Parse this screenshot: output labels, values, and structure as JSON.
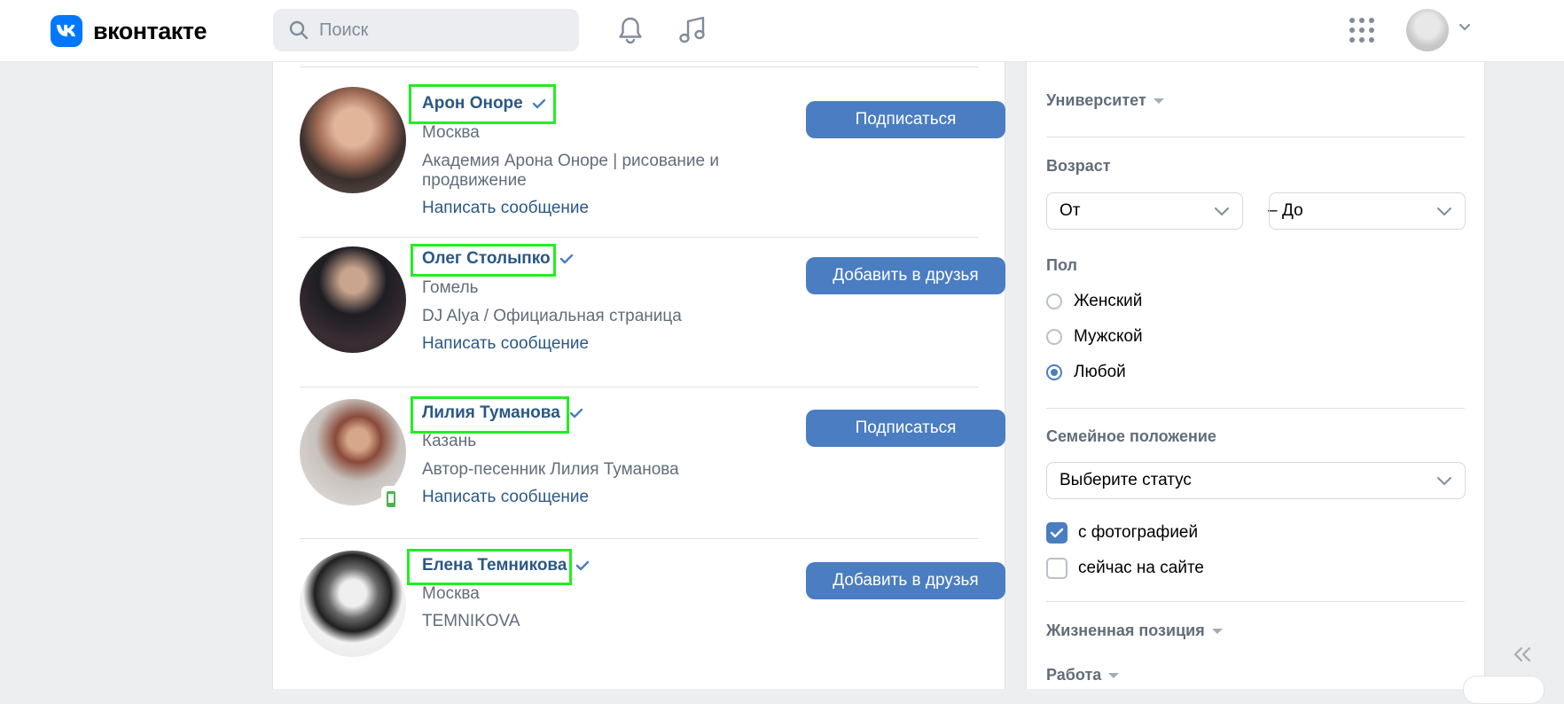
{
  "header": {
    "logo_text": "вконтакте",
    "search_placeholder": "Поиск"
  },
  "people": [
    {
      "name": "Арон Оноре",
      "city": "Москва",
      "desc1": "Академия Арона Оноре | рисование и",
      "desc2": "продвижение",
      "message": "Написать сообщение",
      "button": "Подписаться"
    },
    {
      "name": "Олег Столыпко",
      "city": "Гомель",
      "desc1": "DJ Alya / Официальная страница",
      "message": "Написать сообщение",
      "button": "Добавить в друзья"
    },
    {
      "name": "Лилия Туманова",
      "city": "Казань",
      "desc1": "Автор-песенник Лилия Туманова",
      "message": "Написать сообщение",
      "button": "Подписаться"
    },
    {
      "name": "Елена Темникова",
      "city": "Москва",
      "desc1": "TEMNIKOVA",
      "button": "Добавить в друзья"
    }
  ],
  "filters": {
    "university": "Университет",
    "age_label": "Возраст",
    "age_from": "От",
    "age_to": "До",
    "age_dash": "–",
    "sex_label": "Пол",
    "sex_options": [
      "Женский",
      "Мужской",
      "Любой"
    ],
    "sex_selected": "Любой",
    "family_label": "Семейное положение",
    "family_select": "Выберите статус",
    "with_photo": "с фотографией",
    "online_now": "сейчас на сайте",
    "life_position": "Жизненная позиция",
    "work": "Работа"
  },
  "colors": {
    "vk_blue": "#0077ff",
    "button_blue": "#4a7dc1",
    "link_blue": "#2a5885",
    "highlight_green": "#22ee22"
  }
}
